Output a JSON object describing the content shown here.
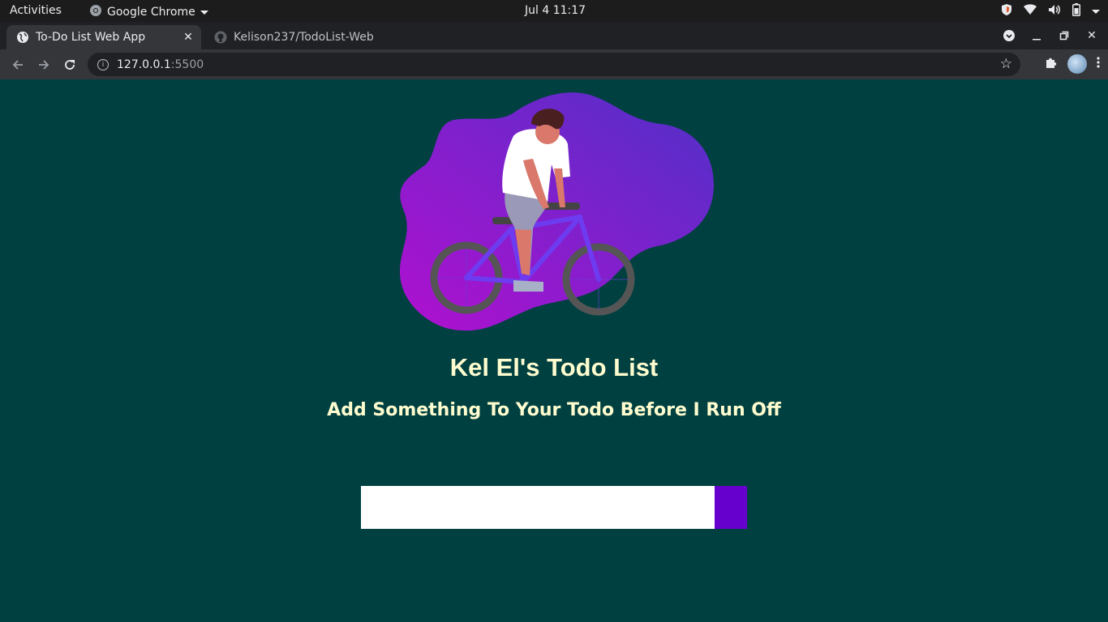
{
  "topbar": {
    "activities": "Activities",
    "app_name": "Google Chrome",
    "clock": "Jul 4  11:17"
  },
  "tabs": [
    {
      "title": "To-Do List Web App",
      "active": true
    },
    {
      "title": "Kelison237/TodoList-Web",
      "active": false
    }
  ],
  "address_bar": {
    "host": "127.0.0.1",
    "port": ":5500"
  },
  "page": {
    "heading": "Kel El's Todo List",
    "subheading": "Add Something To Your Todo Before I Run Off",
    "input": {
      "value": "",
      "placeholder": ""
    },
    "add_button_label": "",
    "colors": {
      "background": "#004040",
      "text": "#fffdd0",
      "button": "#6600cc",
      "blob_start": "#b010d0",
      "blob_end": "#5030c8"
    }
  },
  "icons": {
    "hero": "bicycle-rider-illustration"
  }
}
